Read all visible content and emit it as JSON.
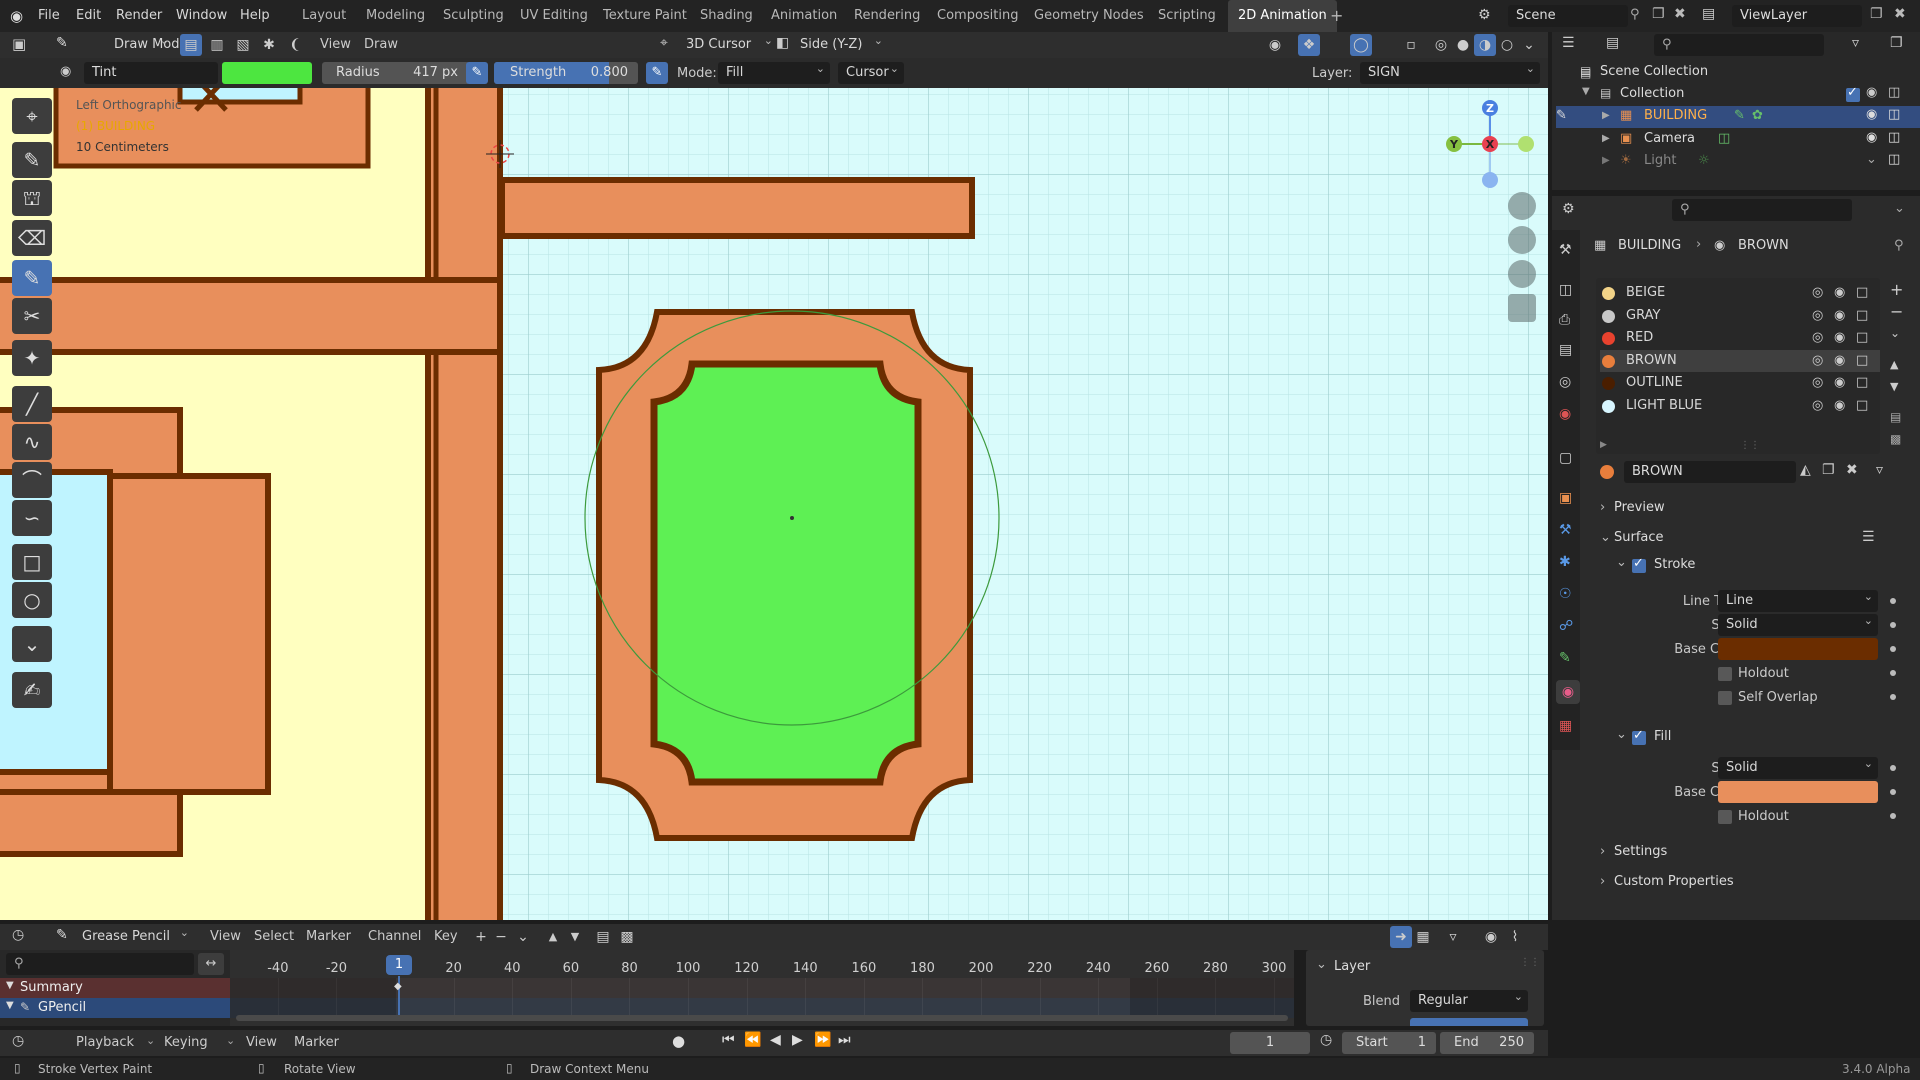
{
  "topbar": {
    "menus": [
      "File",
      "Edit",
      "Render",
      "Window",
      "Help"
    ],
    "workspaces": [
      "Layout",
      "Modeling",
      "Sculpting",
      "UV Editing",
      "Texture Paint",
      "Shading",
      "Animation",
      "Rendering",
      "Compositing",
      "Geometry Nodes",
      "Scripting",
      "2D Animation"
    ],
    "active_workspace": "2D Animation",
    "add_tab": "+",
    "scene": "Scene",
    "view_layer": "ViewLayer"
  },
  "header": {
    "mode": "Draw Mode",
    "view": "View",
    "draw": "Draw",
    "cursor_3d": "3D Cursor",
    "projection": "Side (Y-Z)"
  },
  "tool_settings": {
    "brush": "Tint",
    "brush_color": "#4de640",
    "radius_label": "Radius",
    "radius_value": "417 px",
    "strength_label": "Strength",
    "strength_value": "0.800",
    "strength_fraction": 0.8,
    "mode_label": "Mode:",
    "mode_value": "Fill",
    "cursor_value": "Cursor",
    "layer_label": "Layer:",
    "layer_value": "SIGN"
  },
  "viewport": {
    "view_name": "Left Orthographic",
    "object_name": "(1) BUILDING",
    "scale": "10 Centimeters",
    "gizmo_axes": {
      "z": "Z",
      "y": "Y",
      "x": "X"
    },
    "colors": {
      "background": "#d9fbfb",
      "grid": "#b6e2e2",
      "wall": "#ffffc0",
      "brown": "#e88f5c",
      "outline": "#6b2d00",
      "window": "#bff4ff",
      "sign_fill": "#5ef054"
    }
  },
  "tools": [
    "cursor-icon",
    "draw-icon",
    "fill-icon",
    "erase-icon",
    "tint-icon",
    "cutter-icon",
    "eyedropper-icon",
    "line-icon",
    "polyline-icon",
    "arc-icon",
    "curve-icon",
    "box-icon",
    "circle-icon",
    "interpolate-icon",
    "annotate-icon"
  ],
  "outliner": {
    "scene_collection": "Scene Collection",
    "collection": "Collection",
    "items": [
      "BUILDING",
      "Camera",
      "Light"
    ]
  },
  "properties": {
    "breadcrumb_object": "BUILDING",
    "breadcrumb_material": "BROWN",
    "materials": [
      {
        "name": "BEIGE",
        "color": "#f2d388"
      },
      {
        "name": "GRAY",
        "color": "#c8c8c8"
      },
      {
        "name": "RED",
        "color": "#e8422e"
      },
      {
        "name": "BROWN",
        "color": "#e87e3c"
      },
      {
        "name": "OUTLINE",
        "color": "#4a1e00"
      },
      {
        "name": "LIGHT BLUE",
        "color": "#d8f6ff"
      }
    ],
    "selected_material": "BROWN",
    "material_name": "BROWN",
    "preview": "Preview",
    "surface": "Surface",
    "stroke": "Stroke",
    "line_type_label": "Line Type",
    "line_type": "Line",
    "style_label": "Style",
    "stroke_style": "Solid",
    "base_color_label": "Base Color",
    "stroke_color": "#6b2d00",
    "holdout": "Holdout",
    "self_overlap": "Self Overlap",
    "fill": "Fill",
    "fill_style": "Solid",
    "fill_color": "#e88f5c",
    "fill_holdout": "Holdout",
    "settings": "Settings",
    "custom_properties": "Custom Properties"
  },
  "dopesheet": {
    "editor": "Grease Pencil",
    "menus": [
      "View",
      "Select",
      "Marker",
      "Channel",
      "Key"
    ],
    "ticks": [
      "-40",
      "-20",
      "20",
      "40",
      "60",
      "80",
      "100",
      "120",
      "140",
      "160",
      "180",
      "200",
      "220",
      "240",
      "260",
      "280",
      "300"
    ],
    "current_frame_badge": "1",
    "summary": "Summary",
    "gpencil": "GPencil",
    "layer_panel_title": "Layer",
    "blend_label": "Blend",
    "blend_value": "Regular"
  },
  "timeline": {
    "menus": [
      "Playback",
      "Keying",
      "View",
      "Marker"
    ],
    "current_frame": "1",
    "start_label": "Start",
    "start_value": "1",
    "end_label": "End",
    "end_value": "250"
  },
  "statusbar": {
    "left": "Stroke Vertex Paint",
    "middle": "Rotate View",
    "right": "Draw Context Menu",
    "version": "3.4.0 Alpha"
  }
}
